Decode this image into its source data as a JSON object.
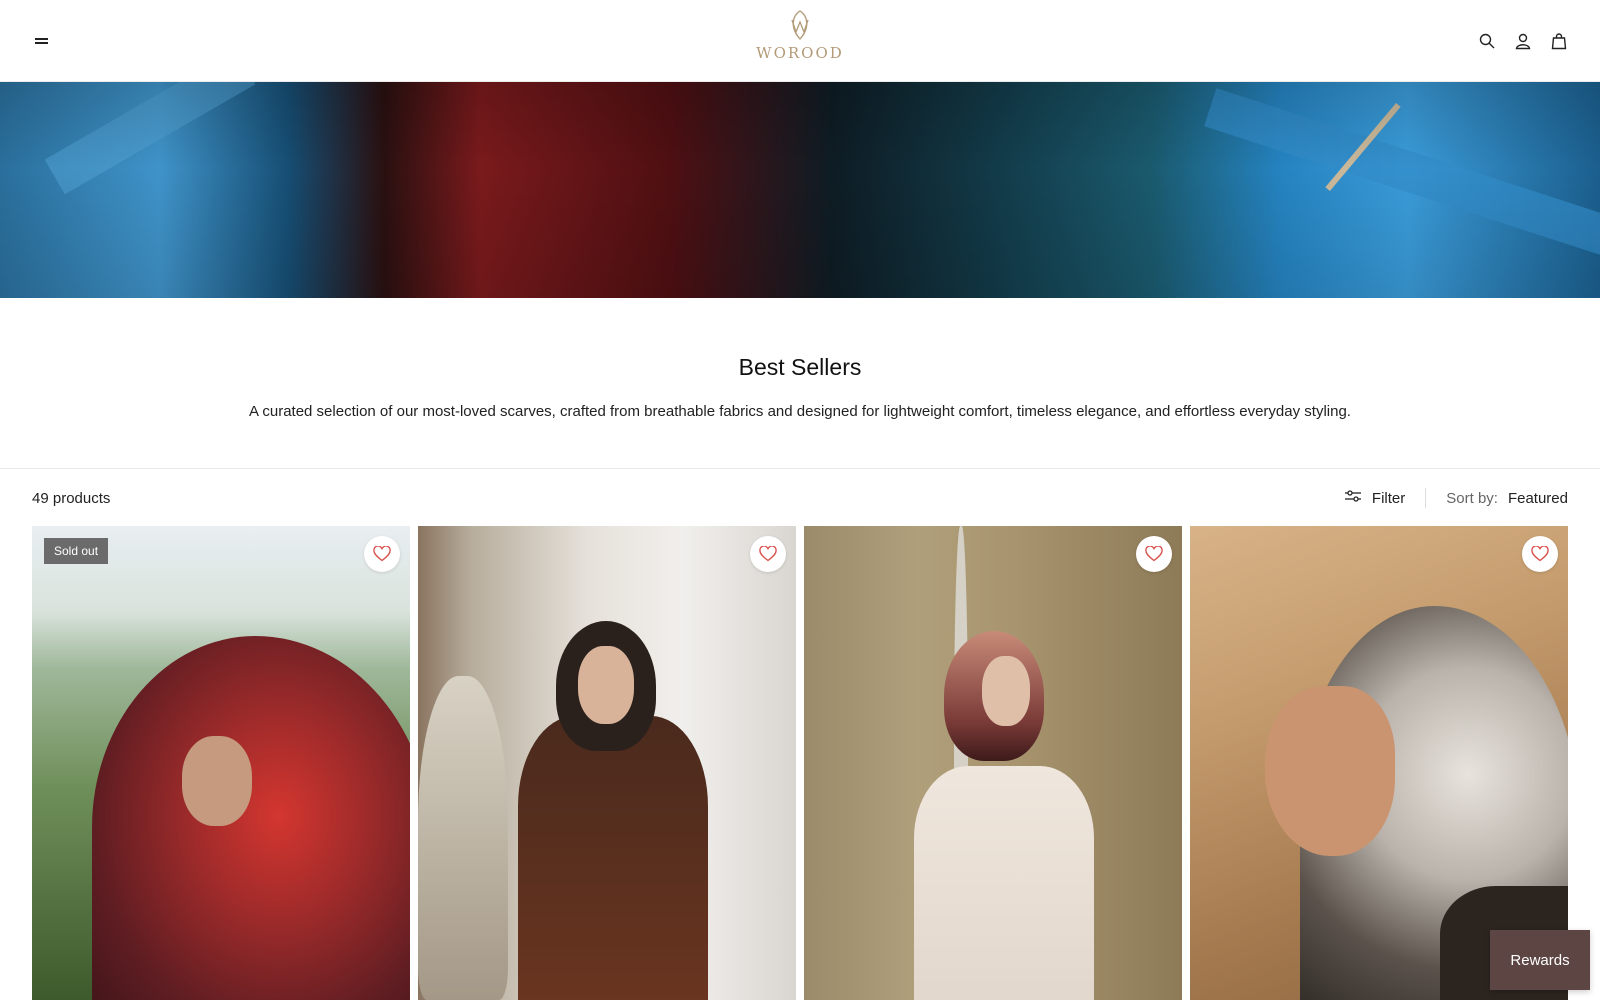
{
  "header": {
    "logo_text": "WOROOD",
    "menu_icon": "hamburger-menu-icon",
    "icons": [
      "search-icon",
      "account-icon",
      "cart-icon"
    ]
  },
  "collection": {
    "title": "Best Sellers",
    "description": "A curated selection of our most-loved scarves, crafted from breathable fabrics and designed for lightweight comfort, timeless elegance, and effortless everyday styling."
  },
  "toolbar": {
    "product_count": "49 products",
    "filter_label": "Filter",
    "sort_label": "Sort by:",
    "sort_value": "Featured"
  },
  "products": [
    {
      "badge": "Sold out"
    },
    {
      "badge": ""
    },
    {
      "badge": ""
    },
    {
      "badge": ""
    }
  ],
  "rewards": {
    "label": "Rewards"
  },
  "colors": {
    "brand_gold": "#b39a78",
    "rewards_bg": "#5c4542",
    "wishlist_heart": "#d9534f",
    "badge_bg": "#6b6b6b"
  }
}
